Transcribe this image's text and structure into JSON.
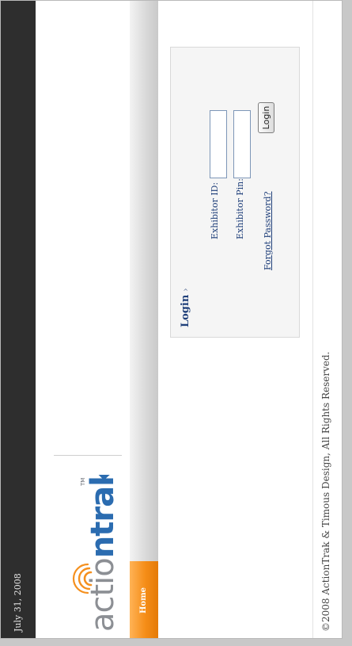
{
  "header": {
    "date": "July 31, 2008"
  },
  "brand": {
    "logo_name": "actiontrak",
    "logo_left": "acti",
    "logo_o": "o",
    "logo_right": "ntrak",
    "trademark": "TM",
    "colors": {
      "gray": "#8c8f94",
      "blue": "#2b6cb0",
      "orange": "#f5901e"
    }
  },
  "nav": {
    "home_label": "Home",
    "home_color": "#f58d18"
  },
  "login": {
    "title": "Login",
    "title_chevron": "›",
    "exhibitor_id_label": "Exhibitor ID:",
    "exhibitor_id_value": "",
    "exhibitor_pin_label": "Exhibitor Pin:",
    "exhibitor_pin_value": "",
    "forgot_label": "Forgot Password?",
    "button_label": "Login"
  },
  "footer": {
    "copyright": "©2008 ActionTrak & Timous Design, All Rights Reserved."
  }
}
